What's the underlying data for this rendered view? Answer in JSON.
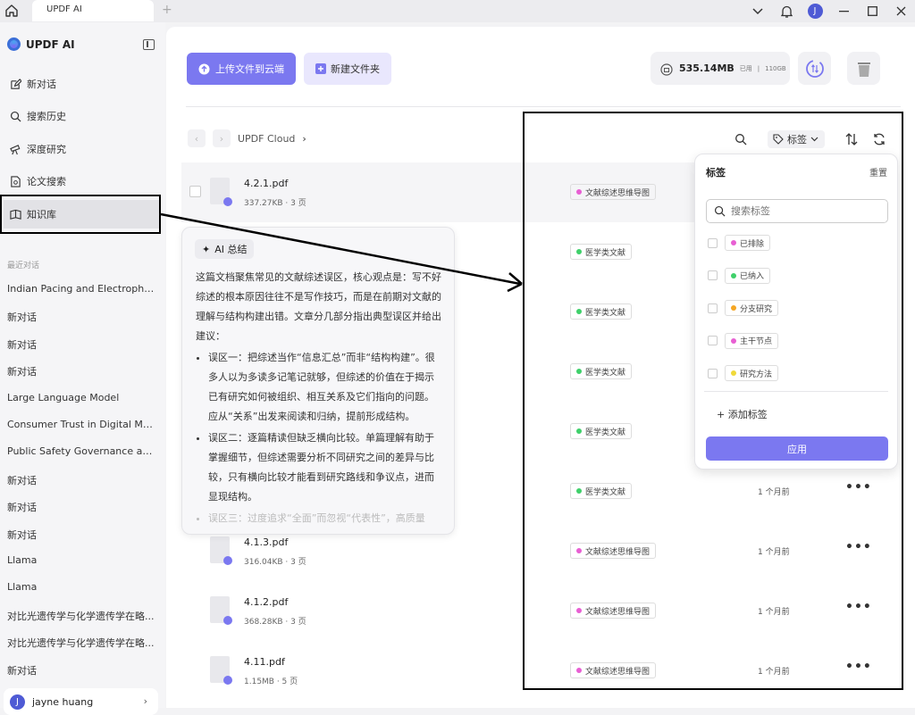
{
  "titlebar": {
    "tab_label": "UPDF AI",
    "avatar_letter": "J"
  },
  "sidebar": {
    "brand": "UPDF AI",
    "nav": [
      {
        "label": "新对话"
      },
      {
        "label": "搜索历史"
      },
      {
        "label": "深度研究"
      },
      {
        "label": "论文搜索"
      },
      {
        "label": "知识库"
      }
    ],
    "recent_title": "最近对话",
    "chats": [
      "Indian Pacing and Electrophy...",
      "新对话",
      "新对话",
      "新对话",
      "Large Language Model",
      "Consumer Trust in Digital Ma...",
      "Public Safety Governance an...",
      "新对话",
      "新对话",
      "新对话",
      "Llama",
      "Llama",
      "对比光遗传学与化学遗传学在略...",
      "对比光遗传学与化学遗传学在略...",
      "新对话"
    ],
    "user_name": "jayne huang",
    "user_initial": "J"
  },
  "main": {
    "upload_label": "上传文件到云端",
    "new_folder_label": "新建文件夹",
    "storage_used": "535.14MB",
    "storage_used_label": "已用",
    "storage_total": "110GB",
    "breadcrumb": "UPDF Cloud",
    "tag_button": "标签"
  },
  "files": [
    {
      "name": "4.2.1.pdf",
      "meta": "337.27KB · 3 页",
      "tag": "文献综述思维导图",
      "tag_color": "#e85fd3",
      "time": ""
    },
    {
      "name": "",
      "meta": "",
      "tag": "医学类文献",
      "tag_color": "#3fd06a",
      "time": ""
    },
    {
      "name": "",
      "meta": "",
      "tag": "医学类文献",
      "tag_color": "#3fd06a",
      "time": ""
    },
    {
      "name": "",
      "meta": "",
      "tag": "医学类文献",
      "tag_color": "#3fd06a",
      "time": ""
    },
    {
      "name": "",
      "meta": "",
      "tag": "医学类文献",
      "tag_color": "#3fd06a",
      "time": ""
    },
    {
      "name": "",
      "meta": "",
      "tag": "医学类文献",
      "tag_color": "#3fd06a",
      "time": "1 个月前"
    },
    {
      "name": "4.1.3.pdf",
      "meta": "316.04KB · 3 页",
      "tag": "文献综述思维导图",
      "tag_color": "#e85fd3",
      "time": "1 个月前"
    },
    {
      "name": "4.1.2.pdf",
      "meta": "368.28KB · 3 页",
      "tag": "文献综述思维导图",
      "tag_color": "#e85fd3",
      "time": "1 个月前"
    },
    {
      "name": "4.11.pdf",
      "meta": "1.15MB · 5 页",
      "tag": "文献综述思维导图",
      "tag_color": "#e85fd3",
      "time": "1 个月前"
    }
  ],
  "ai_summary": {
    "chip": "AI 总结",
    "intro": "这篇文档聚焦常见的文献综述误区，核心观点是：写不好综述的根本原因往往不是写作技巧，而是在前期对文献的理解与结构构建出错。文章分几部分指出典型误区并给出建议：",
    "points": [
      "误区一：把综述当作“信息汇总”而非“结构构建”。很多人以为多读多记笔记就够，但综述的价值在于揭示已有研究如何被组织、相互关系及它们指向的问题。应从“关系”出发来阅读和归纳，提前形成结构。",
      "误区二：逐篇精读但缺乏横向比较。单篇理解有助于掌握细节，但综述需要分析不同研究之间的差异与比较，只有横向比较才能看到研究路线和争议点，进而显现结构。"
    ],
    "faded": "误区三：过度追求“全面”而忽视“代表性”，高质量"
  },
  "tag_dropdown": {
    "title": "标签",
    "reset": "重置",
    "search_placeholder": "搜索标签",
    "items": [
      {
        "label": "已排除",
        "color": "#e85fd3"
      },
      {
        "label": "已纳入",
        "color": "#3fd06a"
      },
      {
        "label": "分支研究",
        "color": "#f5a623"
      },
      {
        "label": "主干节点",
        "color": "#e85fd3"
      },
      {
        "label": "研究方法",
        "color": "#f0d93a"
      }
    ],
    "add_label": "添加标签",
    "apply_label": "应用"
  }
}
